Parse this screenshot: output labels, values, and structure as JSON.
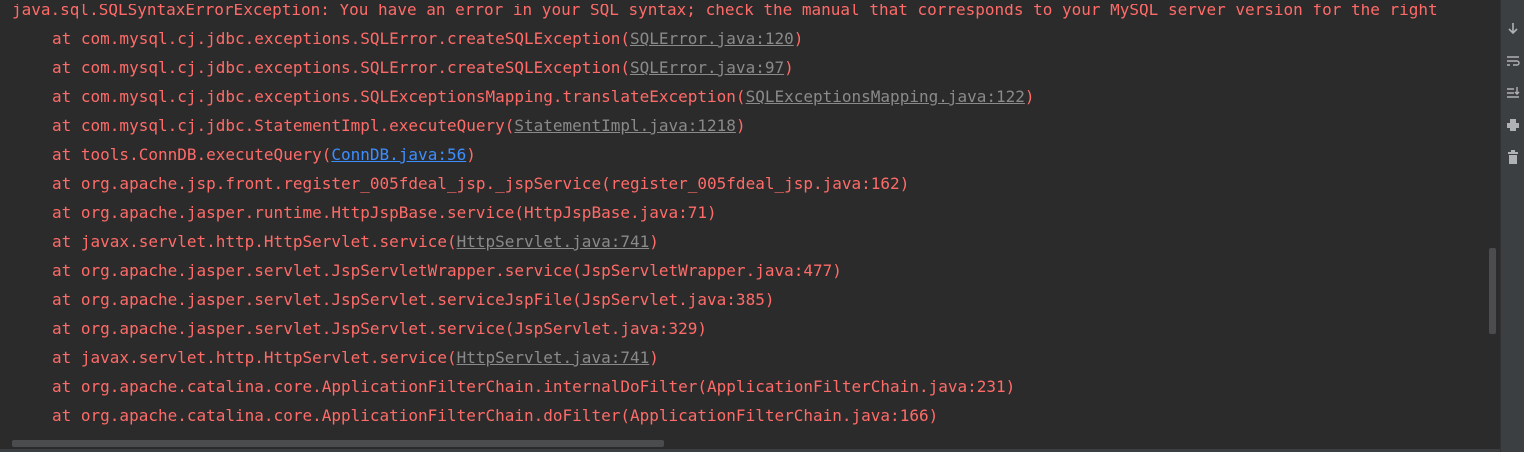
{
  "console": {
    "header_line": "java.sql.SQLSyntaxErrorException: You have an error in your SQL syntax; check the manual that corresponds to your MySQL server version for the right",
    "frames": [
      {
        "prefix": "at com.mysql.cj.jdbc.exceptions.SQLError.createSQLException(",
        "link": "SQLError.java:120",
        "suffix": ")",
        "linked": true,
        "active": false
      },
      {
        "prefix": "at com.mysql.cj.jdbc.exceptions.SQLError.createSQLException(",
        "link": "SQLError.java:97",
        "suffix": ")",
        "linked": true,
        "active": false
      },
      {
        "prefix": "at com.mysql.cj.jdbc.exceptions.SQLExceptionsMapping.translateException(",
        "link": "SQLExceptionsMapping.java:122",
        "suffix": ")",
        "linked": true,
        "active": false
      },
      {
        "prefix": "at com.mysql.cj.jdbc.StatementImpl.executeQuery(",
        "link": "StatementImpl.java:1218",
        "suffix": ")",
        "linked": true,
        "active": false
      },
      {
        "prefix": "at tools.ConnDB.executeQuery(",
        "link": "ConnDB.java:56",
        "suffix": ")",
        "linked": true,
        "active": true
      },
      {
        "prefix": "at org.apache.jsp.front.register_005fdeal_jsp._jspService(register_005fdeal_jsp.java:162)",
        "link": "",
        "suffix": "",
        "linked": false,
        "active": false
      },
      {
        "prefix": "at org.apache.jasper.runtime.HttpJspBase.service(HttpJspBase.java:71)",
        "link": "",
        "suffix": "",
        "linked": false,
        "active": false
      },
      {
        "prefix": "at javax.servlet.http.HttpServlet.service(",
        "link": "HttpServlet.java:741",
        "suffix": ")",
        "linked": true,
        "active": false
      },
      {
        "prefix": "at org.apache.jasper.servlet.JspServletWrapper.service(JspServletWrapper.java:477)",
        "link": "",
        "suffix": "",
        "linked": false,
        "active": false
      },
      {
        "prefix": "at org.apache.jasper.servlet.JspServlet.serviceJspFile(JspServlet.java:385)",
        "link": "",
        "suffix": "",
        "linked": false,
        "active": false
      },
      {
        "prefix": "at org.apache.jasper.servlet.JspServlet.service(JspServlet.java:329)",
        "link": "",
        "suffix": "",
        "linked": false,
        "active": false
      },
      {
        "prefix": "at javax.servlet.http.HttpServlet.service(",
        "link": "HttpServlet.java:741",
        "suffix": ")",
        "linked": true,
        "active": false
      },
      {
        "prefix": "at org.apache.catalina.core.ApplicationFilterChain.internalDoFilter(ApplicationFilterChain.java:231)",
        "link": "",
        "suffix": "",
        "linked": false,
        "active": false
      },
      {
        "prefix": "at org.apache.catalina.core.ApplicationFilterChain.doFilter(ApplicationFilterChain.java:166)",
        "link": "",
        "suffix": "",
        "linked": false,
        "active": false
      }
    ]
  },
  "toolbar": {
    "icons": [
      "scroll-down-arrow-icon",
      "soft-wrap-icon",
      "scroll-to-end-icon",
      "print-icon",
      "trash-icon"
    ]
  },
  "colors": {
    "background": "#2b2b2b",
    "error_text": "#ff6b68",
    "link_gray": "#8a8a8a",
    "link_blue": "#3d8eff",
    "toolbar_bg": "#3c3f41"
  }
}
